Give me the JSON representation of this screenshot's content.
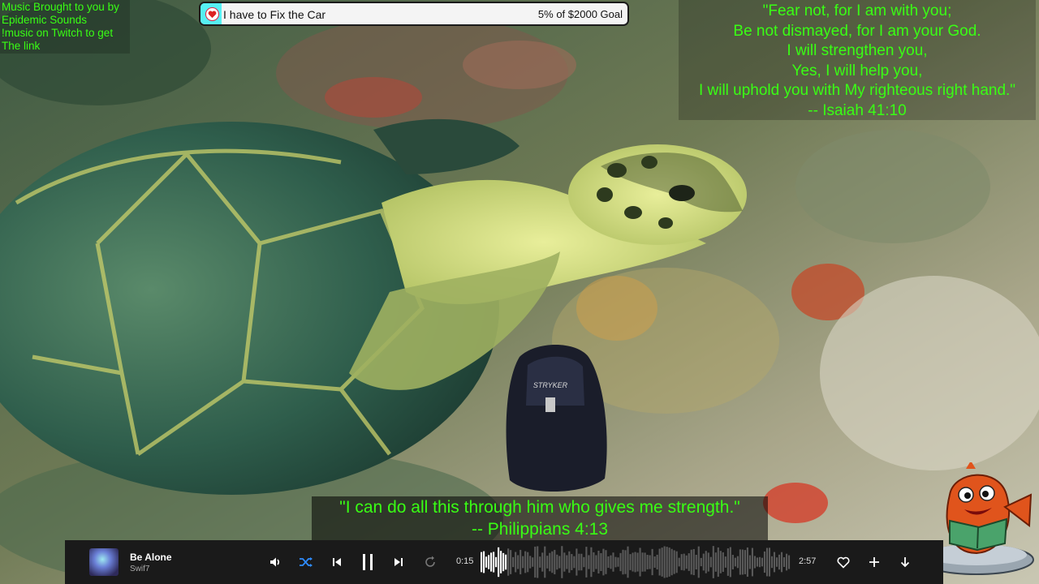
{
  "credit": {
    "lines": [
      "Music Brought to you by",
      "Epidemic Sounds",
      "!music on Twitch to get",
      "The link"
    ]
  },
  "goal": {
    "title": "I have to Fix the Car",
    "amount_text": "5% of $2000 Goal",
    "progress_fraction": 0.05,
    "fill_color": "#56f0f3",
    "icon": "heart-icon"
  },
  "verse_top": {
    "lines": [
      "\"Fear not, for I am with you;",
      "Be not dismayed, for I am your God.",
      "I will strengthen you,",
      "Yes, I will help you,",
      "I will uphold you with My righteous right hand.\"",
      "-- Isaiah 41:10"
    ],
    "color": "#39ff14"
  },
  "verse_bottom": {
    "lines": [
      "\"I can do all this through him who gives me strength.\"",
      "-- Philippians 4:13"
    ],
    "color": "#39ff14"
  },
  "player": {
    "song": "Be Alone",
    "artist": "Swif7",
    "current_time": "0:15",
    "total_time": "2:57",
    "progress_fraction": 0.085,
    "accent": "#2f8cff",
    "icons": [
      "volume-icon",
      "shuffle-icon",
      "previous-icon",
      "pause-icon",
      "next-icon",
      "repeat-icon",
      "heart-icon",
      "plus-icon",
      "download-icon"
    ]
  },
  "chair_brand": "STRYKER"
}
